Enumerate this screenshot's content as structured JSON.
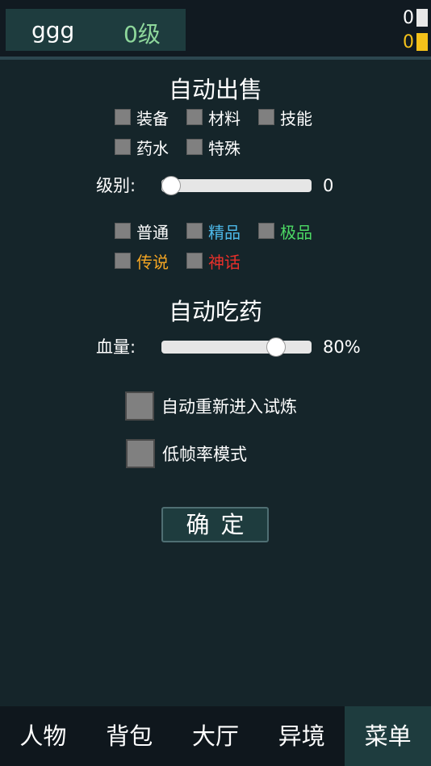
{
  "header": {
    "player_name": "ggg",
    "player_level": "0级",
    "currency_white": "0",
    "currency_gold": "0"
  },
  "auto_sell": {
    "title": "自动出售",
    "categories": [
      "装备",
      "材料",
      "技能",
      "药水",
      "特殊"
    ],
    "level_label": "级别:",
    "level_value": "0",
    "level_fraction": 0,
    "rarities": [
      {
        "label": "普通",
        "color": "#ffffff"
      },
      {
        "label": "精品",
        "color": "#4db8e8"
      },
      {
        "label": "极品",
        "color": "#4cd964"
      },
      {
        "label": "传说",
        "color": "#f5a623"
      },
      {
        "label": "神话",
        "color": "#e8302a"
      }
    ]
  },
  "auto_potion": {
    "title": "自动吃药",
    "hp_label": "血量:",
    "hp_value": "80%",
    "hp_fraction": 0.8
  },
  "options": {
    "auto_reenter": "自动重新进入试炼",
    "low_fps": "低帧率模式"
  },
  "confirm_label": "确定",
  "nav": {
    "items": [
      "人物",
      "背包",
      "大厅",
      "异境",
      "菜单"
    ],
    "active": "菜单"
  },
  "colors": {
    "background": "#15252a",
    "panel": "#1e3c3e",
    "level_text": "#8ed79b",
    "gold": "#f5c21a"
  }
}
